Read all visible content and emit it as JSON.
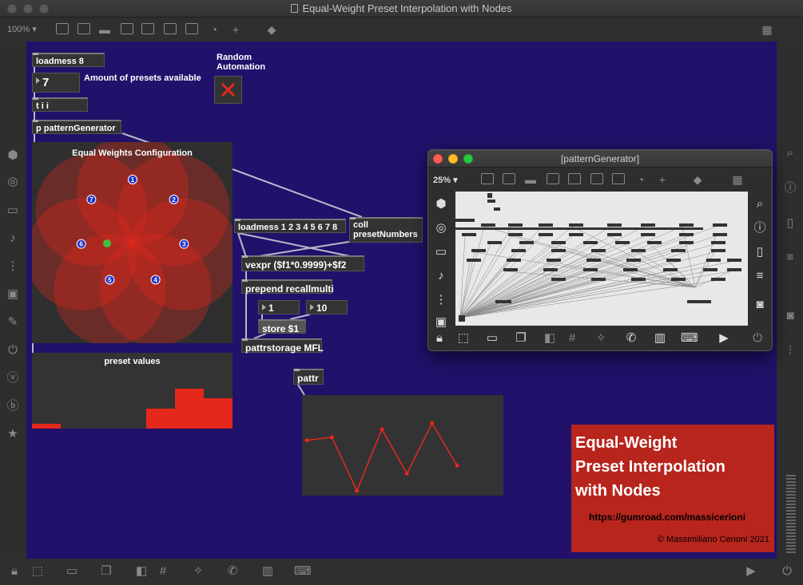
{
  "window": {
    "title": "Equal-Weight Preset Interpolation with Nodes",
    "zoom": "100% ▾"
  },
  "patch": {
    "loadmess8": "loadmess 8",
    "num_presets": "7",
    "amount_label": "Amount of presets available",
    "random_label": "Random\nAutomation",
    "tii": "t i i",
    "pattern_generator": "p patternGenerator",
    "loadmess_list": "loadmess 1 2 3 4 5 6 7 8",
    "coll": "coll\npresetNumbers",
    "vexpr": "vexpr ($f1*0.9999)+$f2",
    "prepend": "prepend recallmulti",
    "num1": "1",
    "num10": "10",
    "store": "store $1",
    "pattrstorage": "pattrstorage MFL",
    "pattr": "pattr"
  },
  "nodes": {
    "title": "Equal Weights Configuration",
    "node_labels": [
      "1",
      "2",
      "3",
      "4",
      "5",
      "6",
      "7"
    ],
    "fill_color": "#e5281c",
    "cursor_color": "#3fbf3f"
  },
  "preset_values": {
    "title": "preset values",
    "values": [
      0.06,
      0,
      0,
      0,
      0.26,
      0.53,
      0.4,
      0
    ],
    "color": "#e5281c"
  },
  "plot": {
    "values": [
      0.55,
      0.58,
      0.05,
      0.66,
      0.22,
      0.72,
      0.3
    ],
    "color": "#e5281c"
  },
  "promo": {
    "title_line1": "Equal-Weight",
    "title_line2": "Preset Interpolation",
    "title_line3": "with Nodes",
    "url": "https://gumroad.com/massicerioni",
    "copyright": "© Massimiliano Cerioni 2021"
  },
  "subwindow": {
    "title": "[patternGenerator]",
    "zoom": "25% ▾"
  }
}
